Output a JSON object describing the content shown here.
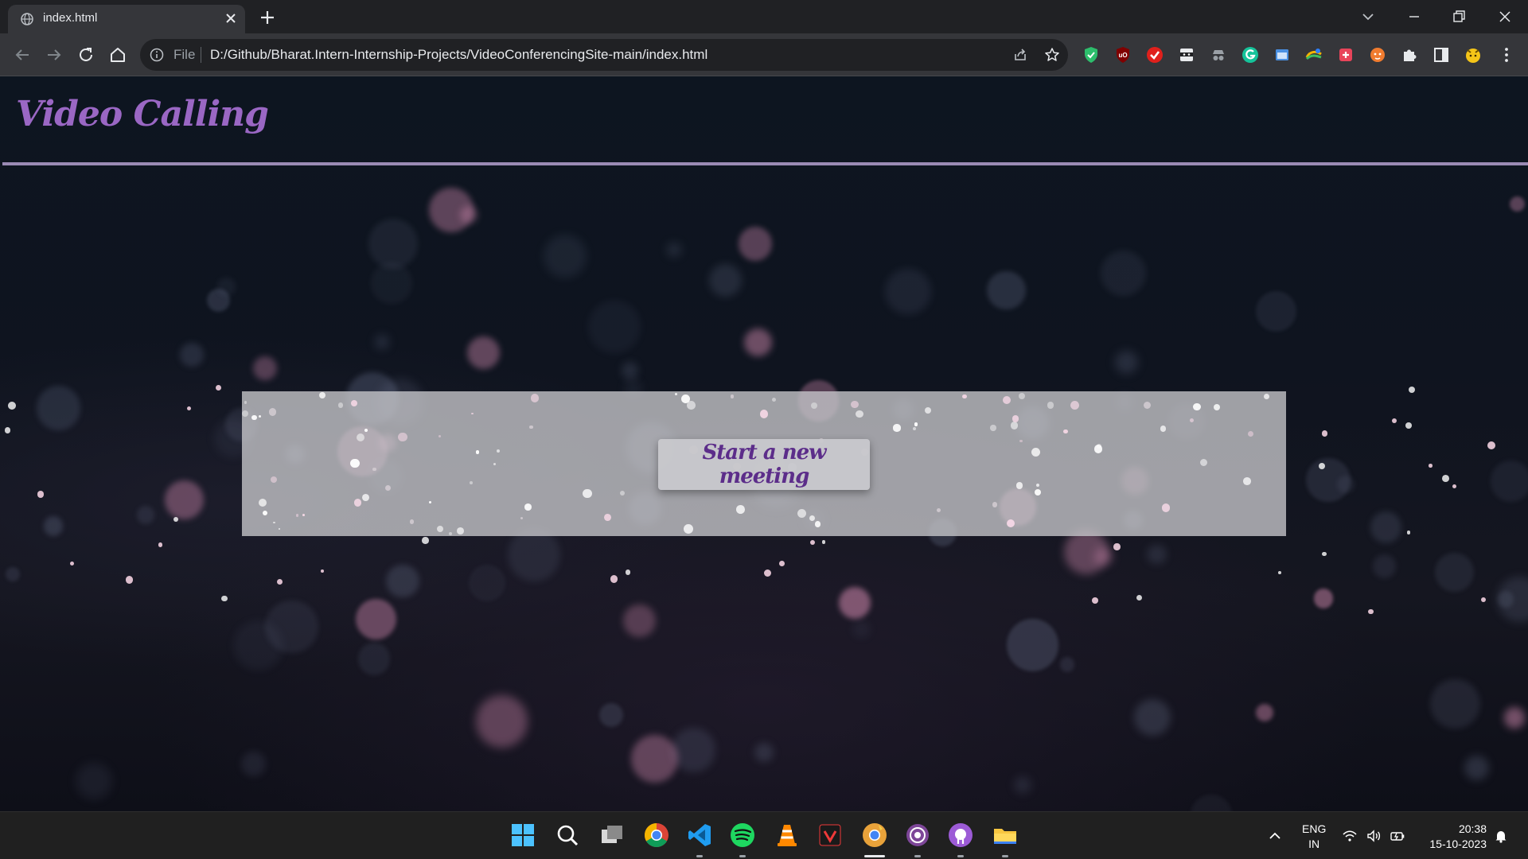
{
  "browser": {
    "tab_title": "index.html",
    "scheme_label": "File",
    "url": "D:/Github/Bharat.Intern-Internship-Projects/VideoConferencingSite-main/index.html"
  },
  "page": {
    "site_title": "Video Calling",
    "start_button_label": "Start a new meeting"
  },
  "taskbar": {
    "apps": [
      "windows-start",
      "search",
      "task-view",
      "chrome",
      "vscode",
      "spotify",
      "vlc",
      "vivaldi",
      "chrome-canary",
      "tor",
      "github-desktop",
      "file-explorer"
    ],
    "language_line1": "ENG",
    "language_line2": "IN",
    "time": "20:38",
    "date": "15-10-2023"
  },
  "colors": {
    "title": "#9a67c4",
    "button_text": "#5c2d8a",
    "header_line": "#9a8ab4"
  }
}
